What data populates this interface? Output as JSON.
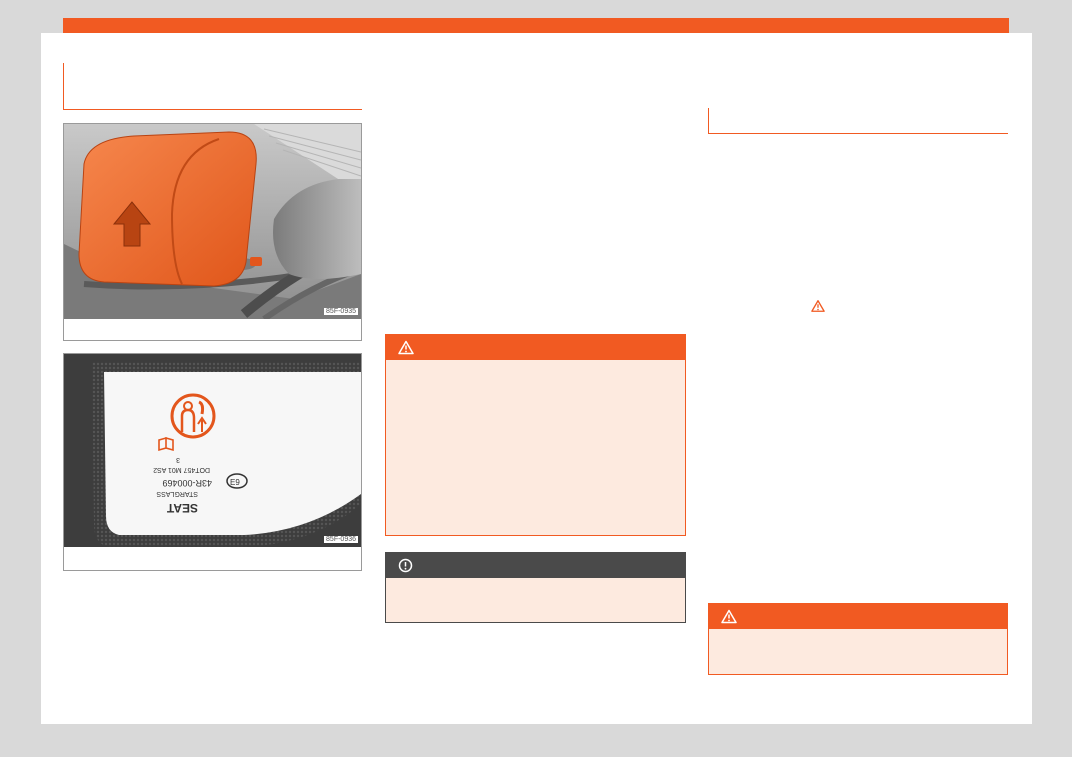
{
  "figures": [
    {
      "code": "85F-0935"
    },
    {
      "code": "85F-0936"
    }
  ],
  "seal": {
    "brand": "SEAT",
    "line1": "STARGLASS",
    "line2": "43R-000469",
    "line3": "DOT457 M01 AS2",
    "line4": "3",
    "mark": "E9"
  },
  "notices": {
    "warning_1": {
      "icon": "warning-triangle-icon"
    },
    "caution_1": {
      "icon": "exclamation-circle-icon"
    },
    "warning_2": {
      "icon": "warning-triangle-icon"
    }
  },
  "colors": {
    "accent": "#f15a22",
    "notice_background": "#fdeadf",
    "caution_header": "#4a4a4a"
  }
}
